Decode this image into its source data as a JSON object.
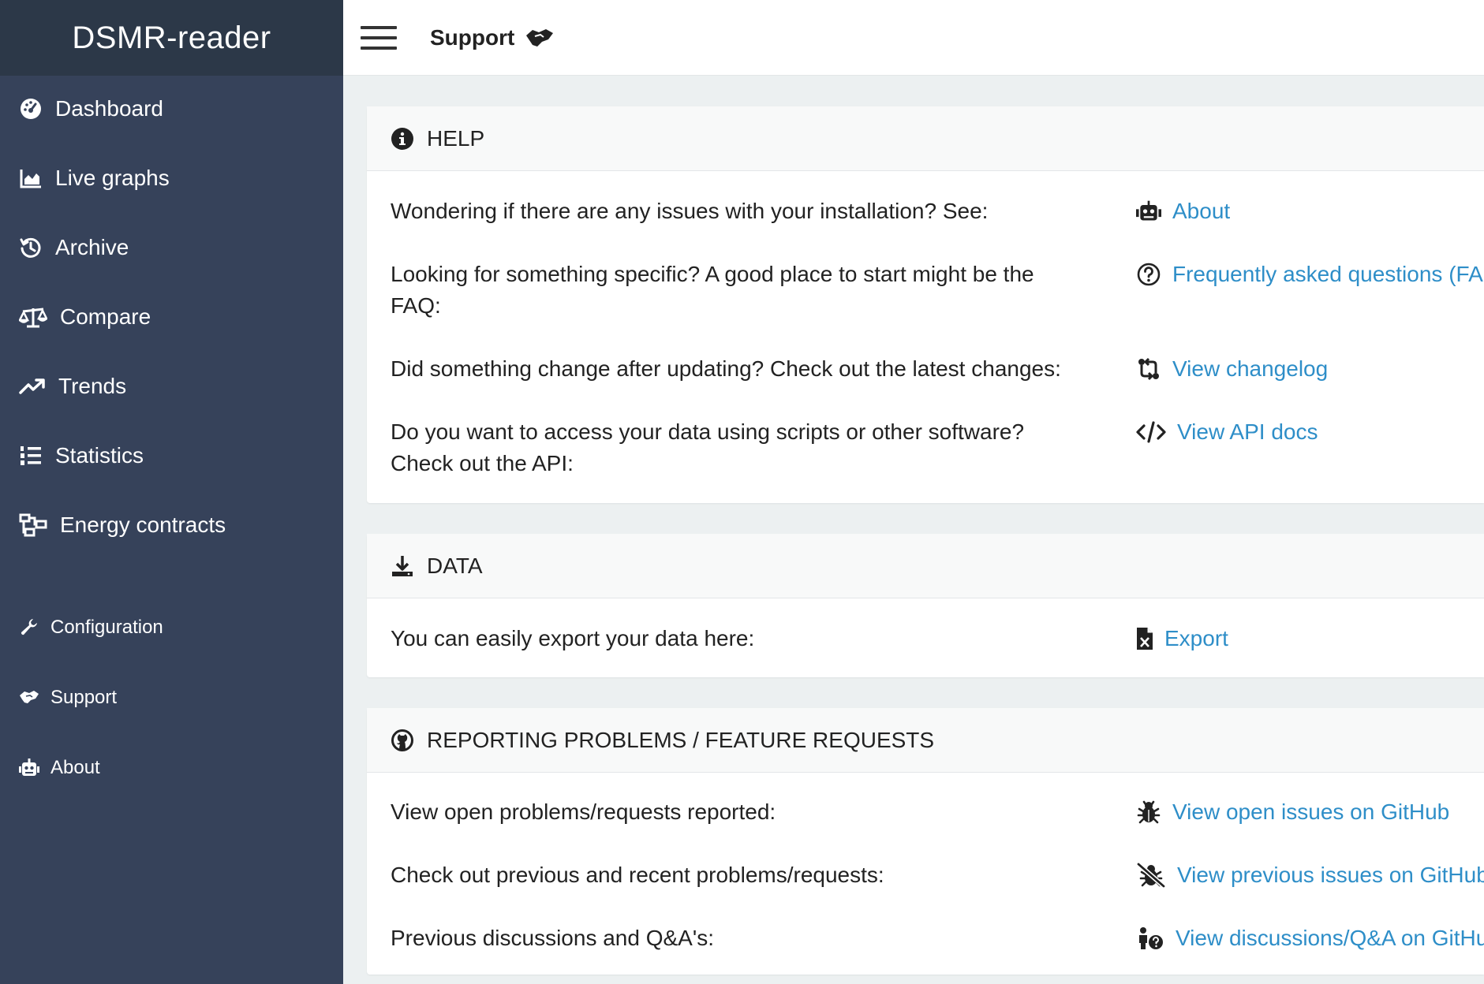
{
  "app": {
    "brand": "DSMR-reader"
  },
  "sidebar": {
    "items": [
      {
        "label": "Dashboard",
        "icon": "tachometer-icon"
      },
      {
        "label": "Live graphs",
        "icon": "area-chart-icon"
      },
      {
        "label": "Archive",
        "icon": "history-icon"
      },
      {
        "label": "Compare",
        "icon": "balance-scale-icon"
      },
      {
        "label": "Trends",
        "icon": "trend-up-icon"
      },
      {
        "label": "Statistics",
        "icon": "list-ordered-icon"
      },
      {
        "label": "Energy contracts",
        "icon": "project-diagram-icon"
      },
      {
        "label": "Configuration",
        "icon": "wrench-icon"
      },
      {
        "label": "Support",
        "icon": "handshake-icon"
      },
      {
        "label": "About",
        "icon": "robot-icon"
      }
    ]
  },
  "header": {
    "title": "Support",
    "title_icon": "handshake-icon"
  },
  "panels": {
    "help": {
      "title": "HELP",
      "icon": "info-circle-icon",
      "rows": [
        {
          "text": "Wondering if there are any issues with your installation? See:",
          "link": "About",
          "icon": "robot-icon"
        },
        {
          "text": "Looking for something specific? A good place to start might be the FAQ:",
          "link": "Frequently asked questions (FAQ)",
          "icon": "question-circle-icon"
        },
        {
          "text": "Did something change after updating? Check out the latest changes:",
          "link": "View changelog",
          "icon": "exchange-icon"
        },
        {
          "text": "Do you want to access your data using scripts or other software? Check out the API:",
          "link": "View API docs",
          "icon": "code-icon"
        }
      ]
    },
    "data": {
      "title": "DATA",
      "icon": "download-icon",
      "rows": [
        {
          "text": "You can easily export your data here:",
          "link": "Export",
          "icon": "file-excel-icon"
        }
      ]
    },
    "reporting": {
      "title": "REPORTING PROBLEMS / FEATURE REQUESTS",
      "icon": "github-icon",
      "rows": [
        {
          "text": "View open problems/requests reported:",
          "link": "View open issues on GitHub",
          "icon": "bug-icon"
        },
        {
          "text": "Check out previous and recent problems/requests:",
          "link": "View previous issues on GitHub",
          "icon": "bug-slash-icon"
        },
        {
          "text": "Previous discussions and Q&A's:",
          "link": "View discussions/Q&A on GitHub",
          "icon": "person-question-icon"
        }
      ]
    }
  },
  "colors": {
    "sidebar": "#36425a",
    "brand_bar": "#2c3848",
    "link": "#2e8ec8",
    "background": "#ecf0f1"
  }
}
